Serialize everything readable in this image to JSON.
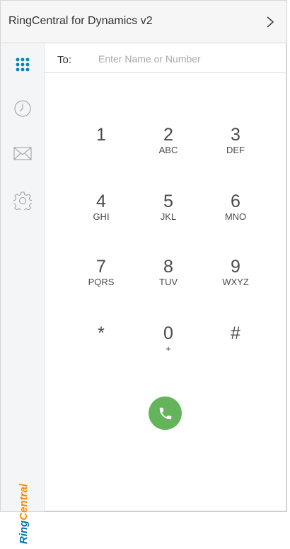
{
  "header": {
    "title": "RingCentral for Dynamics v2",
    "expand_icon": "chevron-right-icon"
  },
  "sidebar": {
    "items": [
      {
        "name": "dialpad",
        "icon": "dialpad-icon",
        "active": true
      },
      {
        "name": "history",
        "icon": "clock-icon"
      },
      {
        "name": "messages",
        "icon": "envelope-icon"
      },
      {
        "name": "settings",
        "icon": "gear-icon"
      }
    ],
    "logo_text": "RingCentral"
  },
  "dialer": {
    "to_label": "To:",
    "to_placeholder": "Enter Name or Number",
    "to_value": ""
  },
  "keypad": [
    {
      "digit": "1",
      "letters": ""
    },
    {
      "digit": "2",
      "letters": "ABC"
    },
    {
      "digit": "3",
      "letters": "DEF"
    },
    {
      "digit": "4",
      "letters": "GHI"
    },
    {
      "digit": "5",
      "letters": "JKL"
    },
    {
      "digit": "6",
      "letters": "MNO"
    },
    {
      "digit": "7",
      "letters": "PQRS"
    },
    {
      "digit": "8",
      "letters": "TUV"
    },
    {
      "digit": "9",
      "letters": "WXYZ"
    },
    {
      "digit": "*",
      "letters": ""
    },
    {
      "digit": "0",
      "letters": "+"
    },
    {
      "digit": "#",
      "letters": ""
    }
  ],
  "call_button": {
    "icon": "phone-icon",
    "color": "#63b45b"
  },
  "colors": {
    "accent": "#0684bd",
    "brand_orange": "#ff8800",
    "brand_blue": "#0073ae"
  }
}
